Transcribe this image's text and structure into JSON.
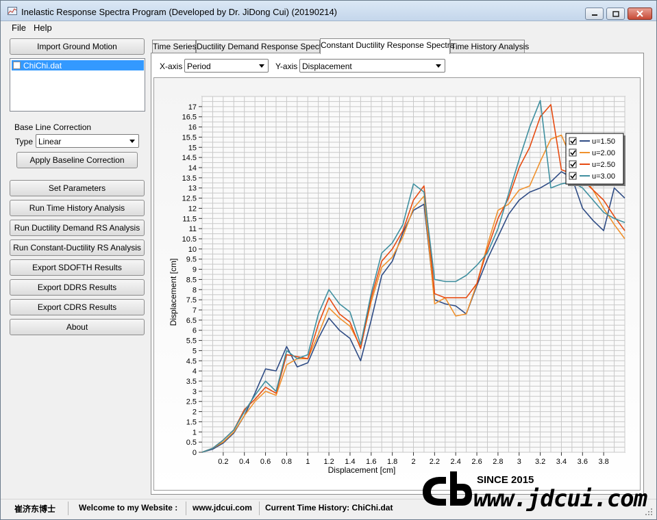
{
  "window": {
    "title": "Inelastic Response Spectra Program (Developed by Dr. JiDong Cui) (20190214)"
  },
  "menu": [
    "File",
    "Help"
  ],
  "left": {
    "import_button": "Import Ground Motion",
    "files": [
      {
        "name": "ChiChi.dat",
        "checked": false,
        "selected": true
      }
    ],
    "baseline": {
      "group_title": "Base Line Correction",
      "type_label": "Type",
      "type_value": "Linear",
      "apply_button": "Apply Baseline Correction"
    },
    "buttons": [
      "Set Parameters",
      "Run Time History Analysis",
      "Run Ductility Demand RS Analysis",
      "Run Constant-Ductility RS Analysis",
      "Export SDOFTH Results",
      "Export DDRS Results",
      "Export CDRS Results",
      "About"
    ]
  },
  "tabs": [
    {
      "label": "Time Series",
      "active": false
    },
    {
      "label": "Ductility Demand Response Spectra",
      "active": false
    },
    {
      "label": "Constant Ductility Response Spectra",
      "active": true
    },
    {
      "label": "Time History Analysis",
      "active": false
    }
  ],
  "axes_select": {
    "x_label": "X-axis",
    "x_value": "Period",
    "y_label": "Y-axis",
    "y_value": "Displacement"
  },
  "status": {
    "author": "崔济东博士",
    "welcome": "Welcome to my Website :",
    "website": "www.jdcui.com",
    "current": "Current Time History: ChiChi.dat"
  },
  "watermark": {
    "since": "SINCE 2015",
    "url": "www.jdcui.com"
  },
  "chart_data": {
    "type": "line",
    "xlabel": "Displacement [cm]",
    "ylabel": "Displacement [cm]",
    "xlim": [
      0,
      4.0
    ],
    "ylim": [
      0,
      17.5
    ],
    "xticks": [
      0.2,
      0.4,
      0.6,
      0.8,
      1,
      1.2,
      1.4,
      1.6,
      1.8,
      2,
      2.2,
      2.4,
      2.6,
      2.8,
      3,
      3.2,
      3.4,
      3.6,
      3.8
    ],
    "yticks": [
      0,
      0.5,
      1,
      1.5,
      2,
      2.5,
      3,
      3.5,
      4,
      4.5,
      5,
      5.5,
      6,
      6.5,
      7,
      7.5,
      8,
      8.5,
      9,
      9.5,
      10,
      10.5,
      11,
      11.5,
      12,
      12.5,
      13,
      13.5,
      14,
      14.5,
      15,
      15.5,
      16,
      16.5,
      17
    ],
    "grid": true,
    "legend_position": "top-right",
    "series": [
      {
        "name": "u=1.50",
        "color": "#2e4b84",
        "x": [
          0,
          0.1,
          0.2,
          0.3,
          0.4,
          0.5,
          0.6,
          0.7,
          0.8,
          0.9,
          1.0,
          1.1,
          1.2,
          1.3,
          1.4,
          1.5,
          1.6,
          1.7,
          1.8,
          1.9,
          2.0,
          2.1,
          2.2,
          2.3,
          2.4,
          2.5,
          2.6,
          2.7,
          2.8,
          2.9,
          3.0,
          3.1,
          3.2,
          3.3,
          3.4,
          3.5,
          3.6,
          3.7,
          3.8,
          3.9,
          4.0
        ],
        "y": [
          0,
          0.15,
          0.45,
          0.95,
          1.8,
          2.9,
          4.1,
          4.0,
          5.2,
          4.2,
          4.4,
          5.6,
          6.6,
          6.0,
          5.6,
          4.5,
          6.5,
          8.7,
          9.4,
          10.8,
          11.9,
          12.2,
          7.5,
          7.3,
          7.2,
          6.8,
          8.2,
          9.5,
          10.6,
          11.7,
          12.4,
          12.8,
          13.0,
          13.3,
          13.8,
          13.5,
          12.0,
          11.4,
          10.9,
          13.0,
          12.5
        ]
      },
      {
        "name": "u=2.00",
        "color": "#f0912c",
        "x": [
          0,
          0.1,
          0.2,
          0.3,
          0.4,
          0.5,
          0.6,
          0.7,
          0.8,
          0.9,
          1.0,
          1.1,
          1.2,
          1.3,
          1.4,
          1.5,
          1.6,
          1.7,
          1.8,
          1.9,
          2.0,
          2.1,
          2.2,
          2.3,
          2.4,
          2.5,
          2.6,
          2.7,
          2.8,
          2.9,
          3.0,
          3.1,
          3.2,
          3.3,
          3.4,
          3.5,
          3.6,
          3.7,
          3.8,
          3.9,
          4.0
        ],
        "y": [
          0,
          0.2,
          0.5,
          1.0,
          1.8,
          2.5,
          3.0,
          2.8,
          4.3,
          4.6,
          4.6,
          5.8,
          7.1,
          6.6,
          6.2,
          5.2,
          7.4,
          9.1,
          9.6,
          10.6,
          12.0,
          12.6,
          7.3,
          7.6,
          6.7,
          6.8,
          8.3,
          10.2,
          11.9,
          12.2,
          12.9,
          13.1,
          14.3,
          15.4,
          15.6,
          14.4,
          13.6,
          12.9,
          12.0,
          11.2,
          10.5
        ]
      },
      {
        "name": "u=2.50",
        "color": "#e64a10",
        "x": [
          0,
          0.1,
          0.2,
          0.3,
          0.4,
          0.5,
          0.6,
          0.7,
          0.8,
          0.9,
          1.0,
          1.1,
          1.2,
          1.3,
          1.4,
          1.5,
          1.6,
          1.7,
          1.8,
          1.9,
          2.0,
          2.1,
          2.2,
          2.3,
          2.4,
          2.5,
          2.6,
          2.7,
          2.8,
          2.9,
          3.0,
          3.1,
          3.2,
          3.3,
          3.4,
          3.5,
          3.6,
          3.7,
          3.8,
          3.9,
          4.0
        ],
        "y": [
          0,
          0.2,
          0.6,
          1.1,
          2.1,
          2.6,
          3.2,
          2.9,
          4.8,
          4.7,
          4.6,
          6.3,
          7.6,
          6.8,
          6.4,
          5.1,
          7.6,
          9.4,
          10.0,
          10.9,
          12.4,
          13.1,
          7.8,
          7.6,
          7.6,
          7.6,
          8.3,
          10.0,
          11.5,
          12.5,
          14.0,
          15.0,
          16.5,
          17.1,
          13.9,
          13.7,
          13.4,
          12.9,
          12.4,
          11.6,
          10.9
        ]
      },
      {
        "name": "u=3.00",
        "color": "#3f8f9f",
        "x": [
          0,
          0.1,
          0.2,
          0.3,
          0.4,
          0.5,
          0.6,
          0.7,
          0.8,
          0.9,
          1.0,
          1.1,
          1.2,
          1.3,
          1.4,
          1.5,
          1.6,
          1.7,
          1.8,
          1.9,
          2.0,
          2.1,
          2.2,
          2.3,
          2.4,
          2.5,
          2.6,
          2.7,
          2.8,
          2.9,
          3.0,
          3.1,
          3.2,
          3.3,
          3.4,
          3.5,
          3.6,
          3.7,
          3.8,
          3.9,
          4.0
        ],
        "y": [
          0,
          0.2,
          0.6,
          1.1,
          2.0,
          2.8,
          3.5,
          3.0,
          5.0,
          4.6,
          4.8,
          6.8,
          8.0,
          7.3,
          6.9,
          5.3,
          7.8,
          9.8,
          10.3,
          11.2,
          13.2,
          12.8,
          8.5,
          8.4,
          8.4,
          8.7,
          9.2,
          9.8,
          11.0,
          12.7,
          14.4,
          16.0,
          17.3,
          13.0,
          13.2,
          13.3,
          13.0,
          12.4,
          11.8,
          11.5,
          11.3
        ]
      }
    ]
  }
}
